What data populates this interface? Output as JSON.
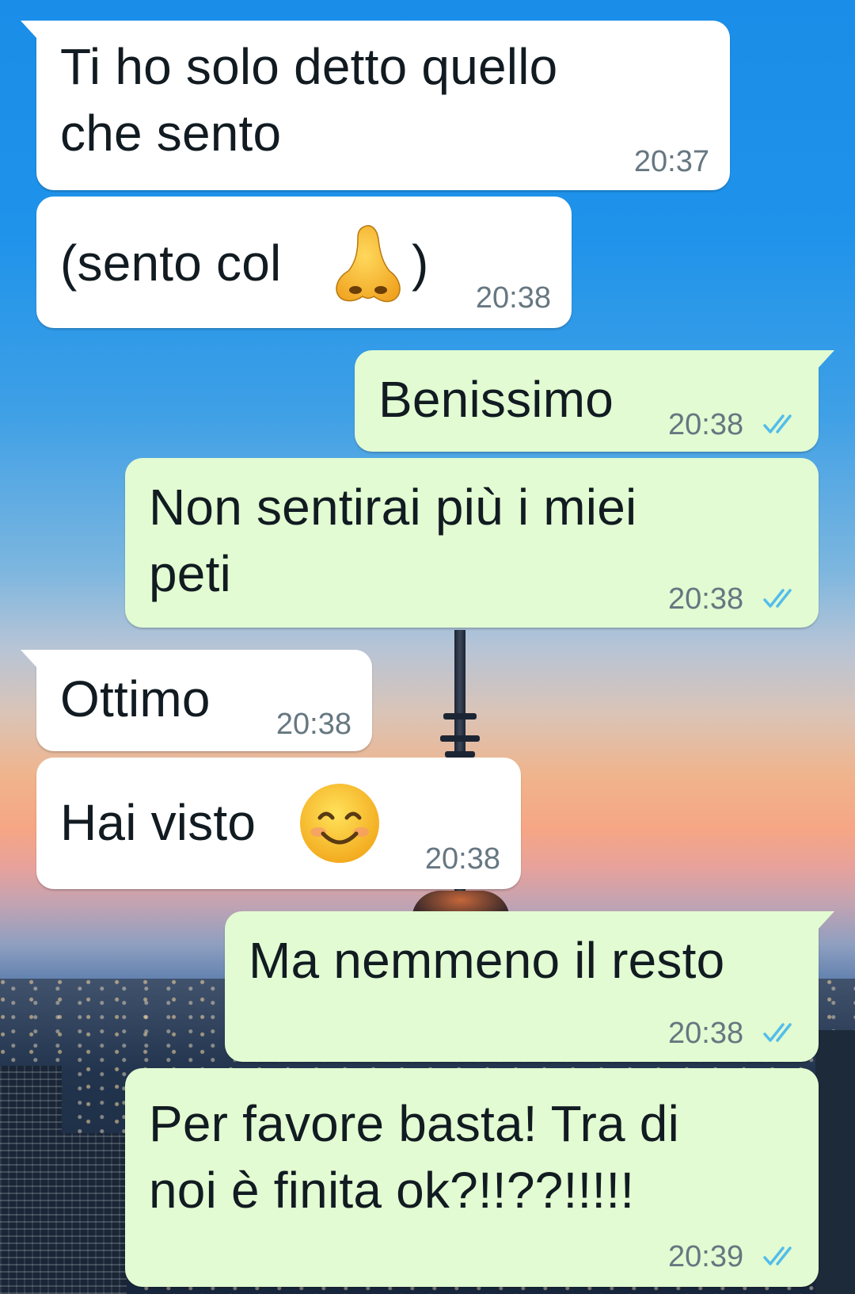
{
  "colors": {
    "incoming_bubble": "#ffffff",
    "outgoing_bubble": "#e2fbd2",
    "timestamp": "#667781",
    "read_ticks": "#53bdeb"
  },
  "messages": [
    {
      "direction": "incoming",
      "text": "Ti ho solo detto quello\nche sento",
      "time": "20:37"
    },
    {
      "direction": "incoming",
      "text": "(sento col",
      "emoji": "nose",
      "text_after": ")",
      "time": "20:38"
    },
    {
      "direction": "outgoing",
      "text": "Benissimo",
      "time": "20:38",
      "status": "read"
    },
    {
      "direction": "outgoing",
      "text": "Non sentirai più i miei\npeti",
      "time": "20:38",
      "status": "read"
    },
    {
      "direction": "incoming",
      "text": "Ottimo",
      "time": "20:38"
    },
    {
      "direction": "incoming",
      "text": "Hai visto",
      "emoji": "smiling-face",
      "time": "20:38"
    },
    {
      "direction": "outgoing",
      "text": "Ma nemmeno il resto",
      "time": "20:38",
      "status": "read"
    },
    {
      "direction": "outgoing",
      "text": "Per favore basta! Tra di\nnoi è finita ok?!!??!!!!!",
      "time": "20:39",
      "status": "read"
    }
  ]
}
